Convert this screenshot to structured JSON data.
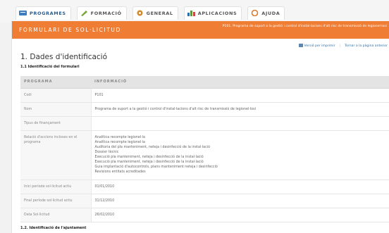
{
  "tabs": [
    {
      "label": "PROGRAMES",
      "icon": "programs-icon",
      "color": "#3b7bbf"
    },
    {
      "label": "FORMACIÓ",
      "icon": "pencil-icon",
      "color": "#7aa33a"
    },
    {
      "label": "GENERAL",
      "icon": "general-icon",
      "color": "#d08a2a"
    },
    {
      "label": "APLICACIONS",
      "icon": "apps-icon",
      "color": "#2f6fa8"
    },
    {
      "label": "AJUDA",
      "icon": "help-icon",
      "color": "#e07a2a"
    }
  ],
  "banner": {
    "title": "FORMULARI DE SOL·LICITUD",
    "right_text": "P101. Programa de suport a la gestió i control d'instal·lacions d'alt risc de transmissió de legionel·losi"
  },
  "actions": {
    "print_label": "Versió per imprimir",
    "back_label": "Tornar a la pàgina anterior"
  },
  "page_title": "1. Dades d'identificació",
  "section1": "1.1 Identificació del formulari",
  "table": {
    "headers": [
      "PROGRAMA",
      "INFORMACIÓ"
    ],
    "rows": [
      {
        "label": "Codi",
        "value": "P101"
      },
      {
        "label": "Nom",
        "value": "Programa de suport a la gestió i control d'instal·lacions d'alt risc de transmissió de legionel·losi"
      },
      {
        "label": "Tipus de finançament",
        "value": ""
      },
      {
        "label": "Relació d'accions incloses en el programa",
        "value": "Analítica recompte legionel·la\nAnalítica recompte legionel·la\nAuditoria del pla manteniment, neteja i desinfecció de la instal·lació\nDossier tècnic\nExecució pla manteniment, neteja i desinfecció de la instal·lació\nExecució pla manteniment, neteja i desinfecció de la instal·lació\nGuia implantació d'autocontrols, plans manteniment neteja i desinfecció\nRevisions entitats acreditades"
      },
      {
        "label": "Inici període sol·licitud actiu",
        "value": "01/01/2010"
      },
      {
        "label": "Final període sol·licitud actiu",
        "value": "31/12/2010"
      },
      {
        "label": "Data Sol·licitud",
        "value": "26/02/2010"
      }
    ]
  },
  "section2": "1.2. Identificació de l'ajuntament"
}
